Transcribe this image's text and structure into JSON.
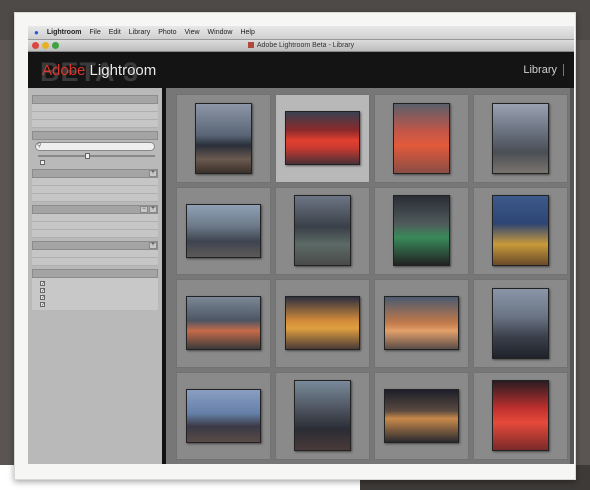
{
  "menubar": {
    "app_name": "Lightroom",
    "items": [
      "File",
      "Edit",
      "Library",
      "Photo",
      "View",
      "Window",
      "Help"
    ]
  },
  "window": {
    "title": "Adobe Lightroom Beta - Library"
  },
  "header": {
    "beta_watermark": "BETA 3",
    "brand_prefix": "Adobe",
    "brand_name": "Lightroom",
    "module": "Library"
  },
  "sidebar": {
    "photo_library": {
      "title": "",
      "rows": [
        {
          "label": "",
          "count": ""
        },
        {
          "label": "",
          "count": ""
        },
        {
          "label": "",
          "count": ""
        }
      ]
    },
    "search": {
      "title": "",
      "placeholder": ""
    },
    "rating": {
      "label": "",
      "checkbox_label": ""
    },
    "browse_by_shoot": {
      "title": "",
      "rows": [
        {
          "label": "",
          "count": ""
        },
        {
          "label": "",
          "count": ""
        },
        {
          "label": "",
          "count": ""
        }
      ]
    },
    "collections": {
      "title": "",
      "rows": [
        {
          "label": "",
          "count": ""
        },
        {
          "label": "",
          "count": ""
        },
        {
          "label": "",
          "count": ""
        }
      ]
    },
    "keywords": {
      "title": "",
      "rows": [
        {
          "label": "",
          "count": ""
        },
        {
          "label": "",
          "count": ""
        }
      ]
    },
    "filter": {
      "title": "",
      "checkboxes": [
        {
          "label": "",
          "checked": true
        },
        {
          "label": "",
          "checked": true
        },
        {
          "label": "",
          "checked": true
        },
        {
          "label": "",
          "checked": true
        },
        {
          "label": "",
          "checked": true
        },
        {
          "label": "",
          "checked": true
        }
      ]
    }
  },
  "grid": {
    "cells": [
      {
        "num": "",
        "selected": false,
        "orient": "port"
      },
      {
        "num": "",
        "selected": true,
        "orient": "land"
      },
      {
        "num": "",
        "selected": false,
        "orient": "port"
      },
      {
        "num": "",
        "selected": false,
        "orient": "port"
      },
      {
        "num": "",
        "selected": false,
        "orient": "land"
      },
      {
        "num": "",
        "selected": false,
        "orient": "port"
      },
      {
        "num": "",
        "selected": false,
        "orient": "port"
      },
      {
        "num": "",
        "selected": false,
        "orient": "port"
      },
      {
        "num": "",
        "selected": false,
        "orient": "land"
      },
      {
        "num": "",
        "selected": false,
        "orient": "land"
      },
      {
        "num": "",
        "selected": false,
        "orient": "land"
      },
      {
        "num": "",
        "selected": false,
        "orient": "port"
      },
      {
        "num": "",
        "selected": false,
        "orient": "land"
      },
      {
        "num": "",
        "selected": false,
        "orient": "port"
      },
      {
        "num": "",
        "selected": false,
        "orient": "land"
      },
      {
        "num": "",
        "selected": false,
        "orient": "port"
      }
    ]
  }
}
